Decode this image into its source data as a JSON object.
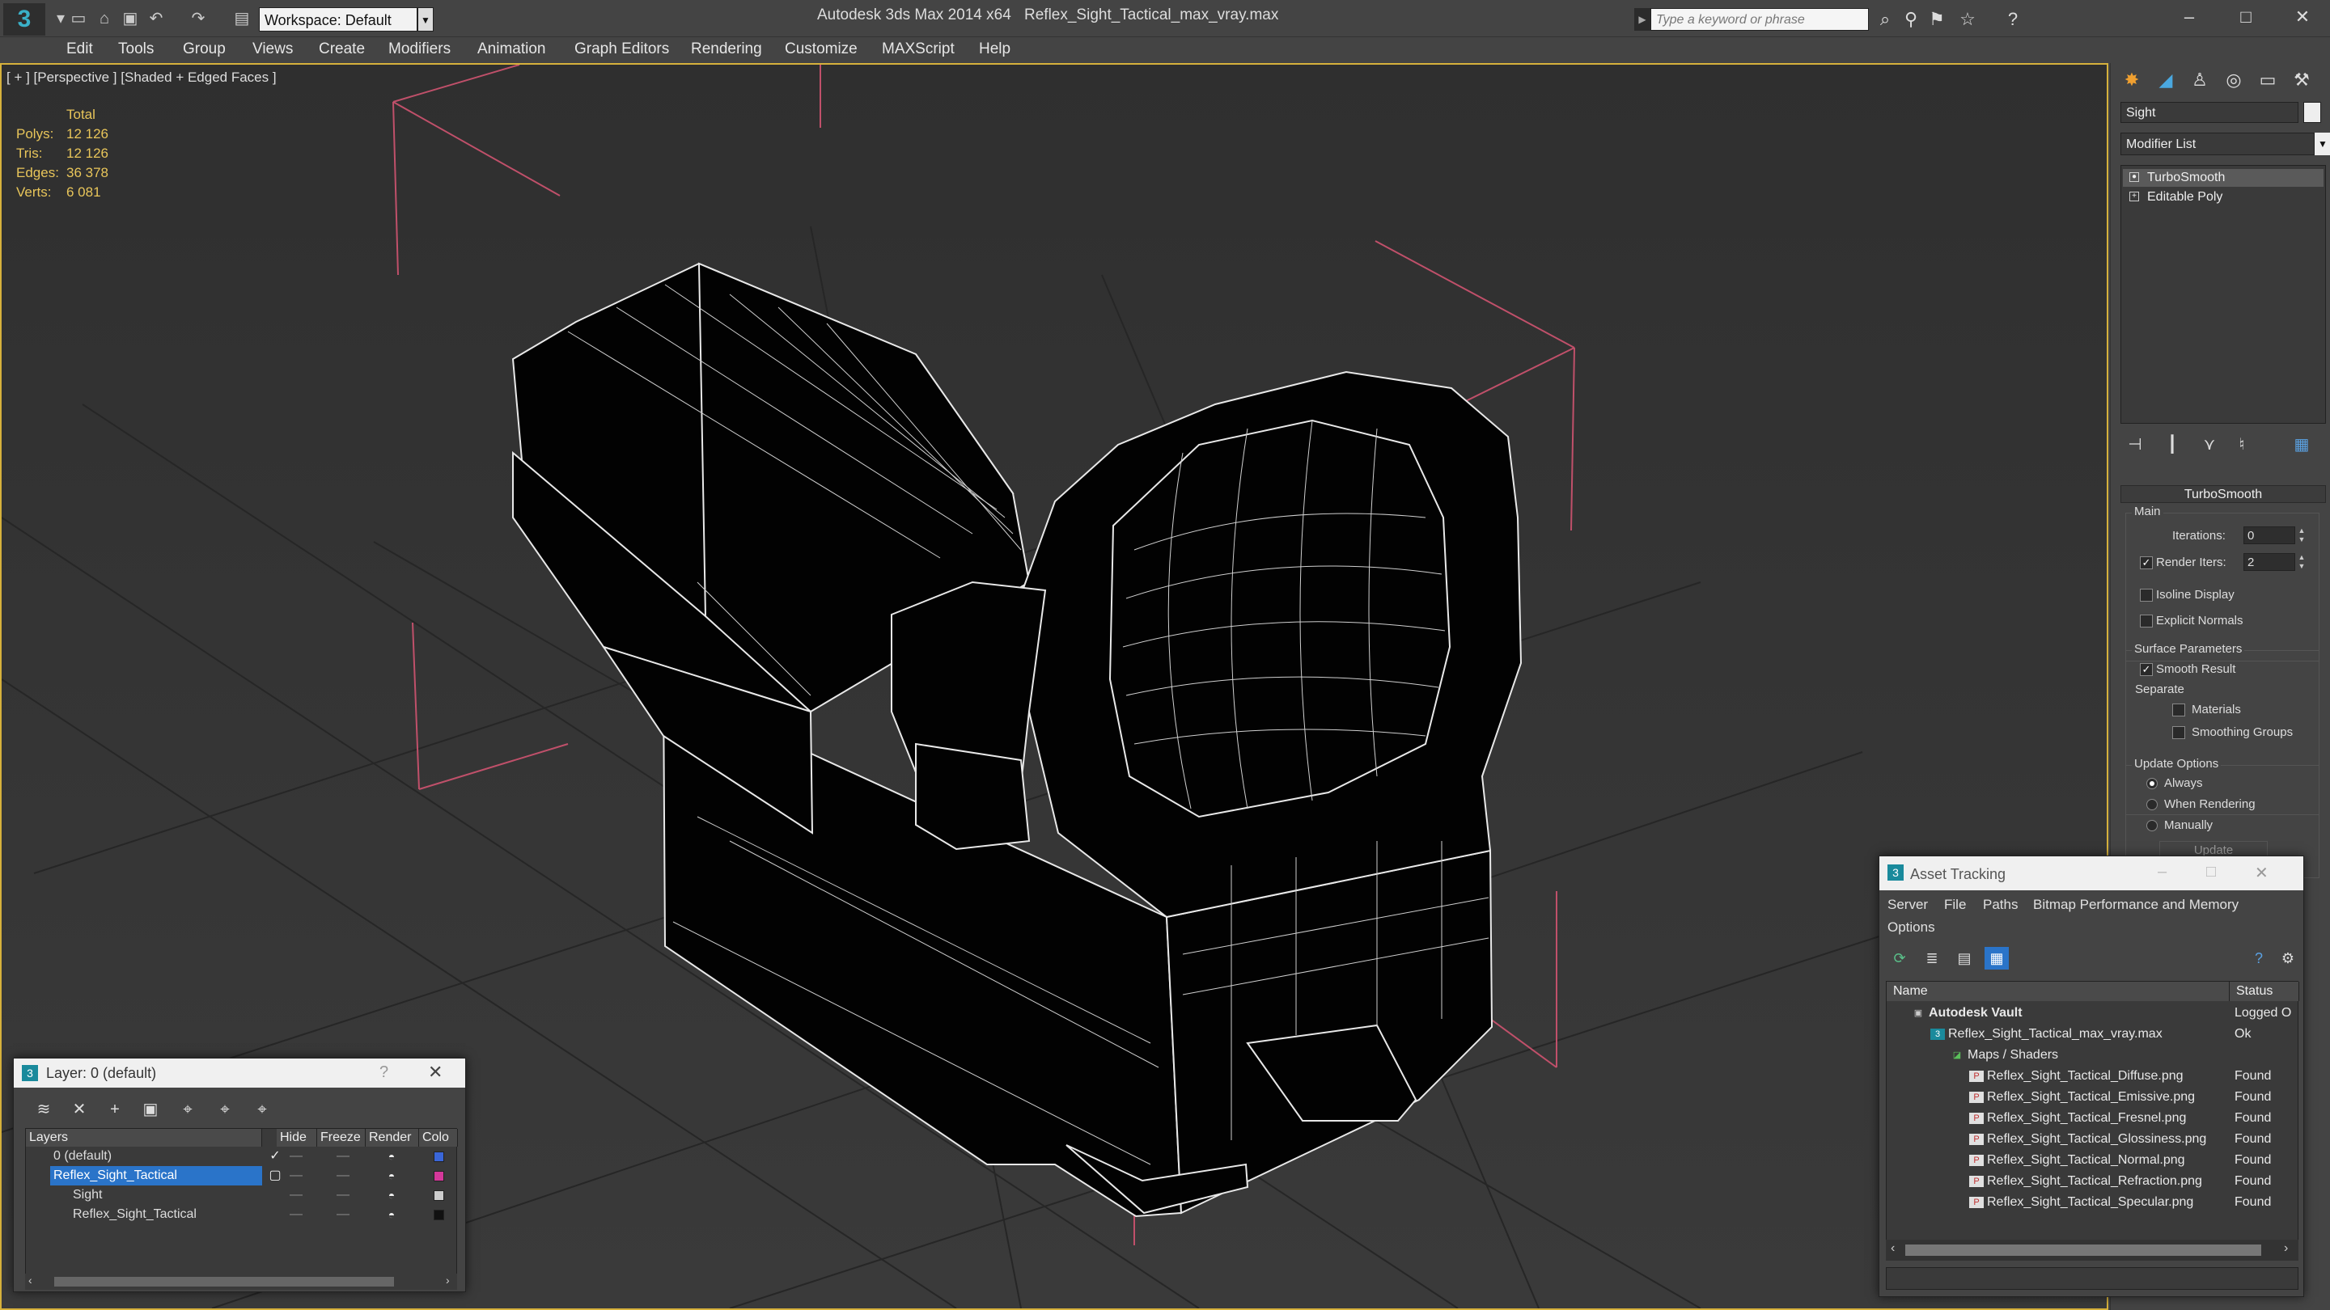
{
  "titlebar": {
    "workspace": "Workspace: Default",
    "app_title": "Autodesk 3ds Max  2014 x64",
    "file_title": "Reflex_Sight_Tactical_max_vray.max",
    "search_placeholder": "Type a keyword or phrase"
  },
  "menu": [
    "Edit",
    "Tools",
    "Group",
    "Views",
    "Create",
    "Modifiers",
    "Animation",
    "Graph Editors",
    "Rendering",
    "Customize",
    "MAXScript",
    "Help"
  ],
  "viewport": {
    "label": "[ + ] [Perspective ] [Shaded + Edged Faces ]",
    "stats": {
      "header": "Total",
      "rows": [
        {
          "label": "Polys:",
          "value": "12 126"
        },
        {
          "label": "Tris:",
          "value": "12 126"
        },
        {
          "label": "Edges:",
          "value": "36 378"
        },
        {
          "label": "Verts:",
          "value": "6 081"
        }
      ]
    }
  },
  "command_panel": {
    "object_name": "Sight",
    "modifier_list": "Modifier List",
    "stack": [
      "TurboSmooth",
      "Editable Poly"
    ],
    "rollout": "TurboSmooth",
    "main_label": "Main",
    "iterations_label": "Iterations:",
    "iterations_value": "0",
    "render_iters_label": "Render Iters:",
    "render_iters_value": "2",
    "isoline": "Isoline Display",
    "explicit": "Explicit Normals",
    "surface_params": "Surface Parameters",
    "smooth_result": "Smooth Result",
    "separate": "Separate",
    "materials": "Materials",
    "smoothing_groups": "Smoothing Groups",
    "update_options": "Update Options",
    "always": "Always",
    "when_rendering": "When Rendering",
    "manually": "Manually",
    "update_btn": "Update"
  },
  "layer_window": {
    "title": "Layer: 0 (default)",
    "columns": [
      "Layers",
      "Hide",
      "Freeze",
      "Render",
      "Colo"
    ],
    "rows": [
      {
        "name": "0 (default)",
        "color": "#3a66d8"
      },
      {
        "name": "Reflex_Sight_Tactical",
        "color": "#d4389a"
      },
      {
        "name": "Sight",
        "color": "#cccccc"
      },
      {
        "name": "Reflex_Sight_Tactical",
        "color": "#111111"
      }
    ]
  },
  "asset_window": {
    "title": "Asset Tracking",
    "menu": [
      "Server",
      "File",
      "Paths",
      "Bitmap Performance and Memory",
      "Options"
    ],
    "columns": [
      "Name",
      "Status"
    ],
    "rows": [
      {
        "name": "Autodesk Vault",
        "status": "Logged O"
      },
      {
        "name": "Reflex_Sight_Tactical_max_vray.max",
        "status": "Ok"
      },
      {
        "name": "Maps / Shaders",
        "status": ""
      },
      {
        "name": "Reflex_Sight_Tactical_Diffuse.png",
        "status": "Found"
      },
      {
        "name": "Reflex_Sight_Tactical_Emissive.png",
        "status": "Found"
      },
      {
        "name": "Reflex_Sight_Tactical_Fresnel.png",
        "status": "Found"
      },
      {
        "name": "Reflex_Sight_Tactical_Glossiness.png",
        "status": "Found"
      },
      {
        "name": "Reflex_Sight_Tactical_Normal.png",
        "status": "Found"
      },
      {
        "name": "Reflex_Sight_Tactical_Refraction.png",
        "status": "Found"
      },
      {
        "name": "Reflex_Sight_Tactical_Specular.png",
        "status": "Found"
      }
    ]
  }
}
